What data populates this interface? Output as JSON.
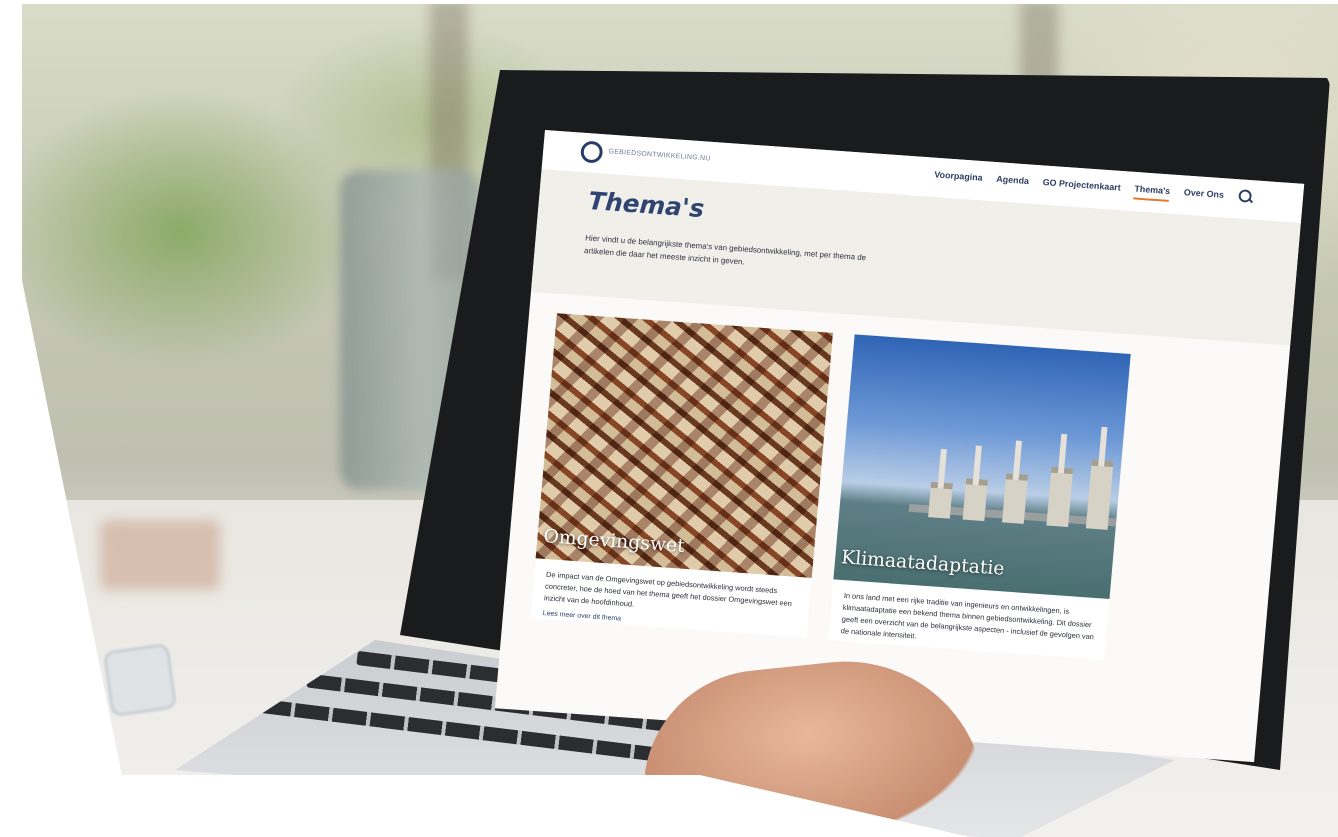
{
  "site": {
    "logo_text": "GEBIEDSONTWIKKELING.NU",
    "nav": [
      {
        "label": "Voorpagina"
      },
      {
        "label": "Agenda"
      },
      {
        "label": "GO Projectenkaart"
      },
      {
        "label": "Thema's",
        "active": true
      },
      {
        "label": "Over Ons"
      }
    ],
    "search_icon": "search-icon",
    "accent_color": "#e27a2c",
    "brand_color": "#2f4470"
  },
  "page": {
    "title": "Thema's",
    "intro": "Hier vindt u de belangrijkste thema's van gebiedsontwikkeling, met per thema de artikelen die daar het meeste inzicht in geven."
  },
  "cards": [
    {
      "title": "Omgevingswet",
      "text": "De impact van de Omgevingswet op gebiedsontwikkeling wordt steeds concreter, hoe de hoed van het thema geeft het dossier Omgevingswet een inzicht van de hoofdinhoud.",
      "link": "Lees meer over dit thema"
    },
    {
      "title": "Klimaatadaptatie",
      "text": "In ons land met een rijke traditie van ingenieurs en ontwikkelingen, is klimaatadaptatie een bekend thema binnen gebiedsontwikkeling. Dit dossier geeft een overzicht van de belangrijkste aspecten - inclusief de gevolgen van de nationale intensiteit."
    }
  ]
}
